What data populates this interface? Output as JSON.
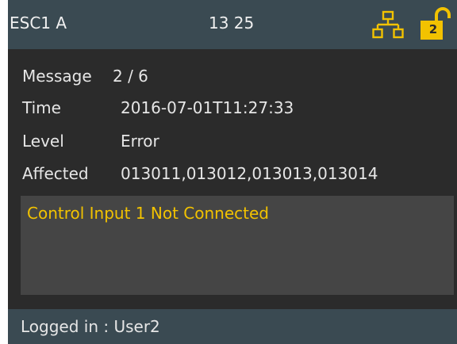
{
  "header": {
    "title": "ESC1 A",
    "clock": "13 25",
    "network_icon": "network-icon",
    "lock_icon": "unlocked-padlock-icon",
    "lock_level": "2",
    "accent_color": "#f2c200"
  },
  "details": {
    "message_label": "Message",
    "message_value": "2 / 6",
    "time_label": "Time",
    "time_value": "2016-07-01T11:27:33",
    "level_label": "Level",
    "level_value": "Error",
    "affected_label": "Affected",
    "affected_value": "013011,013012,013013,013014"
  },
  "message_box": {
    "text": "Control Input 1 Not Connected"
  },
  "footer": {
    "status": "Logged in : User2"
  }
}
